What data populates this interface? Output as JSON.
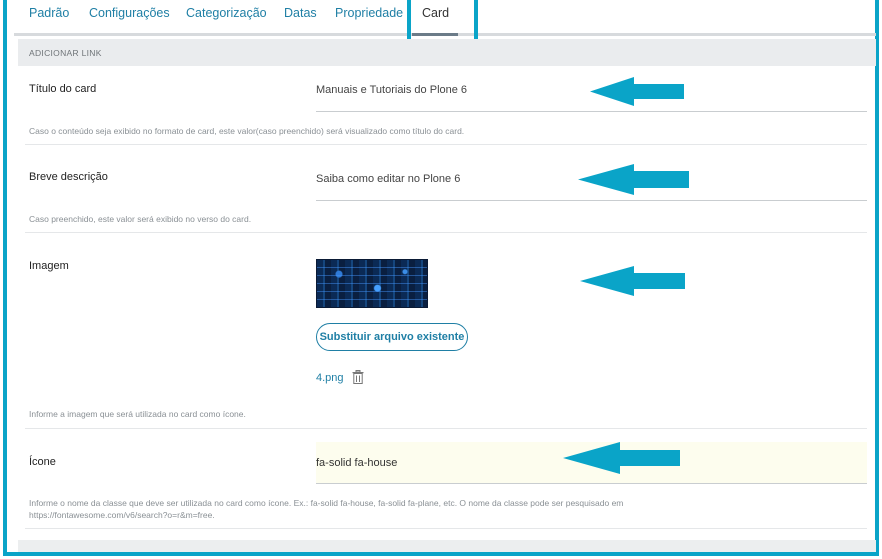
{
  "tabs": [
    {
      "label": "Padrão"
    },
    {
      "label": "Configurações"
    },
    {
      "label": "Categorização"
    },
    {
      "label": "Datas"
    },
    {
      "label": "Propriedade"
    },
    {
      "label": "Card"
    }
  ],
  "active_tab": "Card",
  "section": {
    "title": "ADICIONAR LINK"
  },
  "fields": {
    "card_title": {
      "label": "Título do card",
      "value": "Manuais e Tutoriais do Plone 6",
      "help": "Caso o conteúdo seja exibido no formato de card, este valor(caso preenchido) será visualizado como título do card."
    },
    "short_description": {
      "label": "Breve descrição",
      "value": "Saiba como editar no Plone 6",
      "help": "Caso preenchido, este valor será exibido no verso do card."
    },
    "image": {
      "label": "Imagem",
      "replace_button": "Substituir arquivo existente",
      "filename": "4.png",
      "help": "Informe a imagem que será utilizada no card como ícone."
    },
    "icon": {
      "label": "Ícone",
      "value": "fa-solid fa-house",
      "help_line1": "Informe o nome da classe que deve ser utilizada no card como ícone. Ex.: fa-solid fa-house, fa-solid fa-plane, etc. O nome da classe pode ser pesquisado em",
      "help_line2": "https://fontawesome.com/v6/search?o=r&m=free."
    }
  },
  "colors": {
    "accent": "#0aa4c8",
    "link": "#1f7fa5",
    "icon_field_bg": "#fdfdee"
  },
  "icons": {
    "arrow": "left-arrow-icon",
    "trash": "trash-icon"
  }
}
